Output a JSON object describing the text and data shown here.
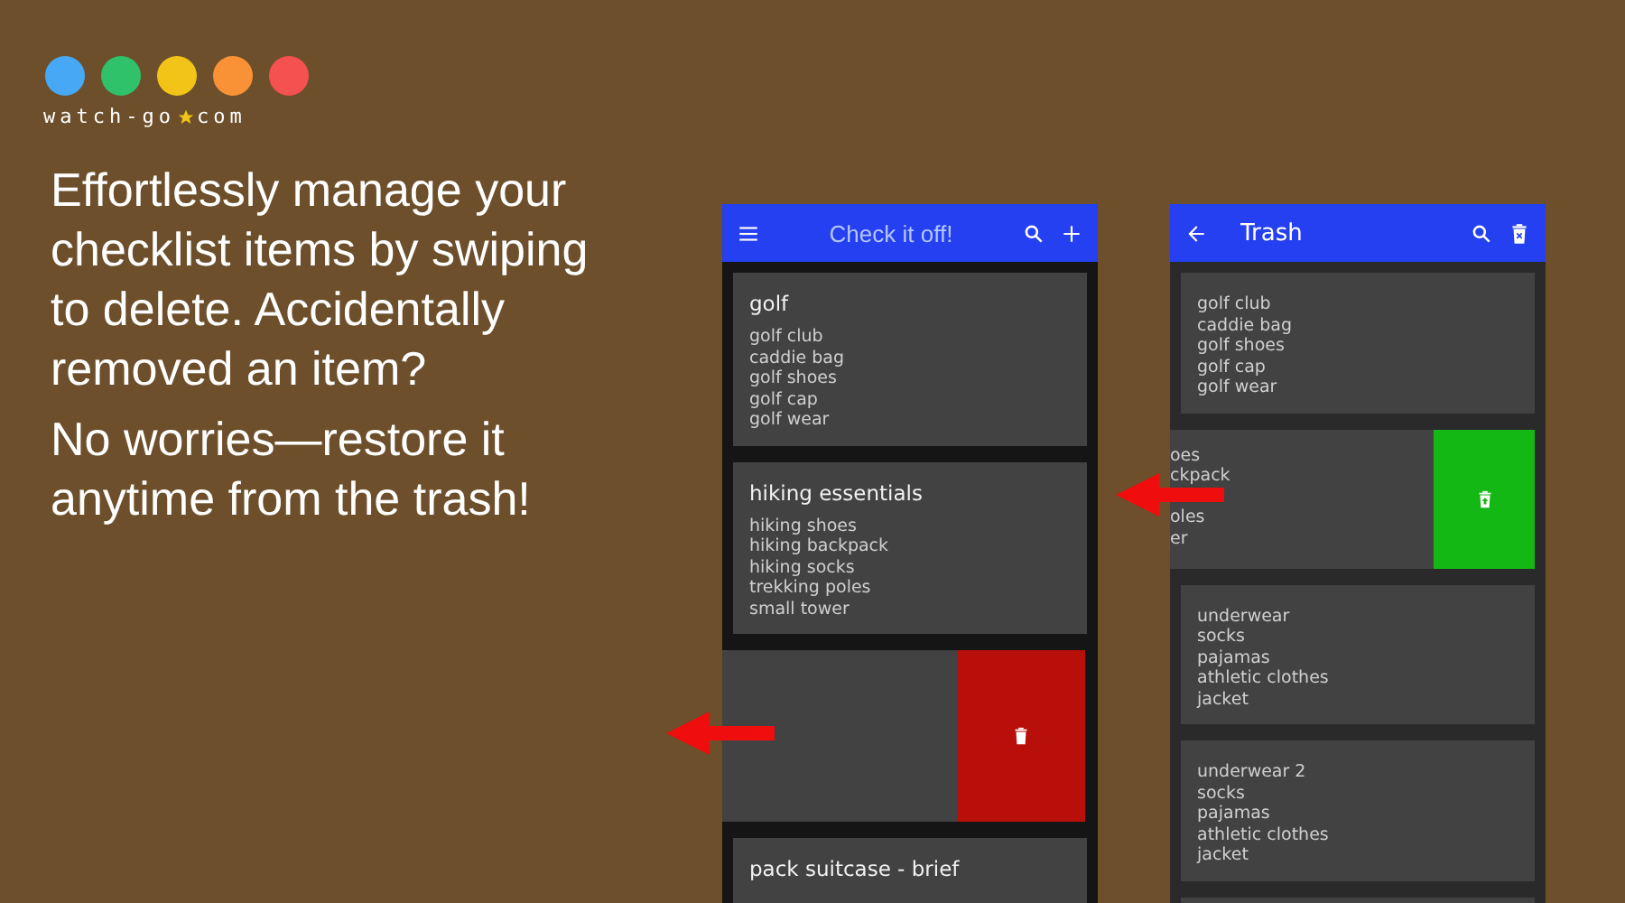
{
  "promo": {
    "logo": {
      "text_before": "watch-go",
      "text_after": "com"
    },
    "headline": [
      "Effortlessly manage your checklist items by swiping to delete. Accidentally removed an item?",
      "No worries—restore it anytime from the trash!"
    ]
  },
  "phones": [
    {
      "kind": "lists",
      "header": {
        "title": "Check it off!"
      },
      "cards": [
        {
          "kind": "card",
          "title": "golf",
          "lines": [
            "golf club",
            "caddie bag",
            "golf shoes",
            "golf cap",
            "golf wear"
          ]
        },
        {
          "kind": "card",
          "title": "hiking essentials",
          "lines": [
            "hiking shoes",
            "hiking backpack",
            "hiking socks",
            "trekking poles",
            "small tower"
          ]
        },
        {
          "kind": "swiped-delete"
        },
        {
          "kind": "card",
          "title": "pack suitcase - brief"
        }
      ]
    },
    {
      "kind": "trash",
      "header": {
        "title": "Trash"
      },
      "cards": [
        {
          "kind": "card",
          "lines": [
            "golf club",
            "caddie bag",
            "golf shoes",
            "golf cap",
            "golf wear"
          ]
        },
        {
          "kind": "swiped-restore",
          "lines": [
            "oes",
            "ckpack",
            "oles",
            "er"
          ]
        },
        {
          "kind": "card",
          "lines": [
            "underwear",
            "socks",
            "pajamas",
            "athletic clothes",
            "jacket"
          ]
        },
        {
          "kind": "card",
          "lines": [
            "underwear 2",
            "socks",
            "pajamas",
            "athletic clothes",
            "jacket"
          ]
        },
        {
          "kind": "card"
        }
      ]
    }
  ]
}
